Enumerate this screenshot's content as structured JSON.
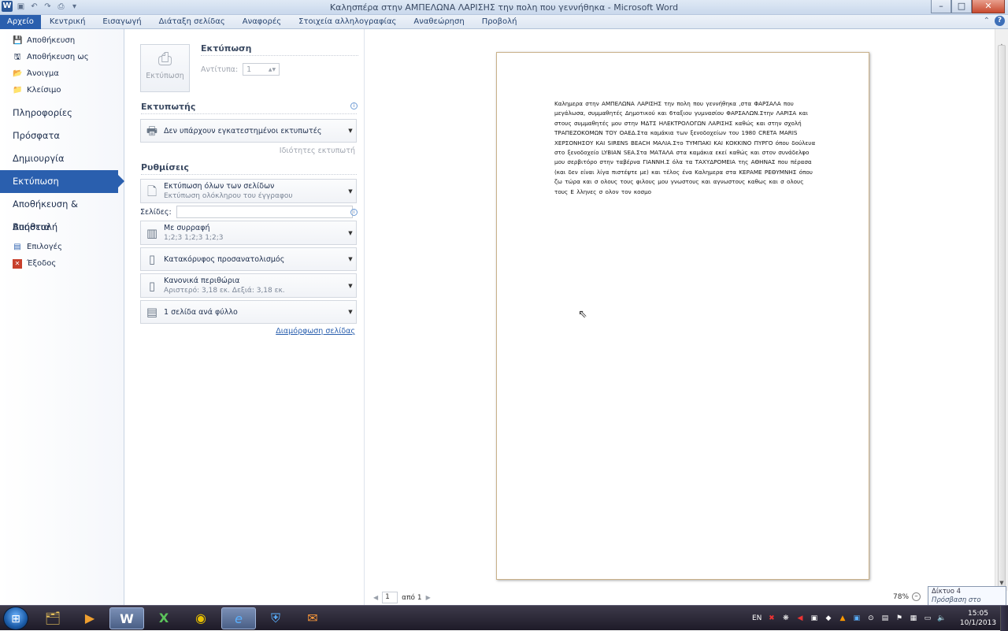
{
  "window": {
    "title": "Καλησπέρα στην ΑΜΠΕΛΩΝΑ ΛΑΡΙΣΗΣ την πολη που γεννήθηκα - Microsoft Word",
    "app_icon": "W"
  },
  "ribbon": {
    "tabs": [
      "Αρχείο",
      "Κεντρική",
      "Εισαγωγή",
      "Διάταξη σελίδας",
      "Αναφορές",
      "Στοιχεία αλληλογραφίας",
      "Αναθεώρηση",
      "Προβολή"
    ],
    "active_tab": "Αρχείο"
  },
  "backstage": {
    "small_items": [
      {
        "label": "Αποθήκευση",
        "icon": "save-icon"
      },
      {
        "label": "Αποθήκευση ως",
        "icon": "save-as-icon"
      },
      {
        "label": "Άνοιγμα",
        "icon": "open-folder-icon"
      },
      {
        "label": "Κλείσιμο",
        "icon": "close-folder-icon"
      }
    ],
    "big_items": [
      "Πληροφορίες",
      "Πρόσφατα",
      "Δημιουργία",
      "Εκτύπωση",
      "Αποθήκευση & Αποστολή",
      "Βοήθεια"
    ],
    "active_item": "Εκτύπωση",
    "bottom_items": [
      {
        "label": "Επιλογές",
        "icon": "options-icon"
      },
      {
        "label": "Έξοδος",
        "icon": "exit-icon"
      }
    ]
  },
  "print": {
    "button_label": "Εκτύπωση",
    "heading": "Εκτύπωση",
    "copies_label": "Αντίτυπα:",
    "copies_value": "1",
    "printer_heading": "Εκτυπωτής",
    "printer_value": "Δεν υπάρχουν εγκατεστημένοι εκτυπωτές",
    "printer_properties": "Ιδιότητες εκτυπωτή",
    "settings_heading": "Ρυθμίσεις",
    "range_title": "Εκτύπωση όλων των σελίδων",
    "range_sub": "Εκτύπωση ολόκληρου του έγγραφου",
    "pages_label": "Σελίδες:",
    "pages_value": "",
    "collate_title": "Με συρραφή",
    "collate_sub": "1;2;3    1;2;3    1;2;3",
    "orientation": "Κατακόρυφος προσανατολισμός",
    "margins_title": "Κανονικά περιθώρια",
    "margins_sub": "Αριστερό:  3,18 εκ.    Δεξιά:  3,18 εκ.",
    "per_sheet": "1 σελίδα ανά φύλλο",
    "page_setup_link": "Διαμόρφωση σελίδας"
  },
  "preview": {
    "document_text": "Καλημερα  στην ΑΜΠΕΛΩΝΑ  ΛΑΡΙΣΗΣ την πολη που γεννήθηκα  ,στα ΦΑΡΣΑΛΑ  που μεγάλωσα, συμμαθητές Δημοτικού και 6ταξιου γυμνασίου ΦΑΡΣΑΛΩΝ.Στην  ΛΑΡΙΣΑ και στους συμμαθητές  μου στην ΜΔΤΣ  ΗΛΕΚΤΡΟΛΟΓΩΝ  ΛΑΡΙΣΗΣ καθώς και στην σχολή ΤΡΑΠΕΖΟΚΟΜΩΝ   ΤΟΥ ΟΑΕΔ.Στα  καμάκια των ξενοδοχείων του 1980 CRETA MARIS ΧΕΡΣΟΝΗΣΟΥ  KAI SIRENS BEACH ΜΑΛΙΑ.Στο  ΤΥΜΠΑΚΙ  ΚΑΙ ΚΟΚΚΙΝΟ ΠΥΡΓΟ όπου δούλευα στο ξενοδοχείο LYBIAN SEA.Στα  ΜΑΤΑΛΑ  στα καμάκια  εκεί καθώς και στον συνάδελφο  μου σερβιτόρο στην ταβέρνα  ΓΙΑΝΝΗ.Σ όλα τα ΤΑΧΥΔΡΟΜΕΙΑ   της ΑΘΗΝΑΣ  που πέρασα (και δεν είναι λίγα πιστέψτε  με) και τέλος ένα Καλημερα  στα ΚΕΡΑΜΕ  ΡΕΘΥΜΝΗΣ  όπου ζω τώρα και σ ολους τους φιλους μου γνωστους και αγνωστους καθως και σ ολους τους Ε λληνες σ ολον τον κοσμο",
    "page_current": "1",
    "page_of": "από 1",
    "zoom": "78%"
  },
  "tooltip": {
    "line1": "Δίκτυο  4",
    "line2": "Πρόσβαση στο Internet"
  },
  "taskbar": {
    "language": "EN",
    "time": "15:05",
    "date": "10/1/2013",
    "apps": [
      {
        "name": "explorer-app",
        "glyph": "🗂"
      },
      {
        "name": "media-player-app",
        "glyph": "▶"
      },
      {
        "name": "word-app",
        "glyph": "W"
      },
      {
        "name": "excel-app",
        "glyph": "X"
      },
      {
        "name": "chrome-app",
        "glyph": "◉"
      },
      {
        "name": "ie-app",
        "glyph": "e"
      },
      {
        "name": "security-app",
        "glyph": "⛨"
      },
      {
        "name": "mail-app",
        "glyph": "✉"
      }
    ]
  },
  "colors": {
    "accent": "#2a5fae",
    "page_border": "#c9b18a"
  }
}
